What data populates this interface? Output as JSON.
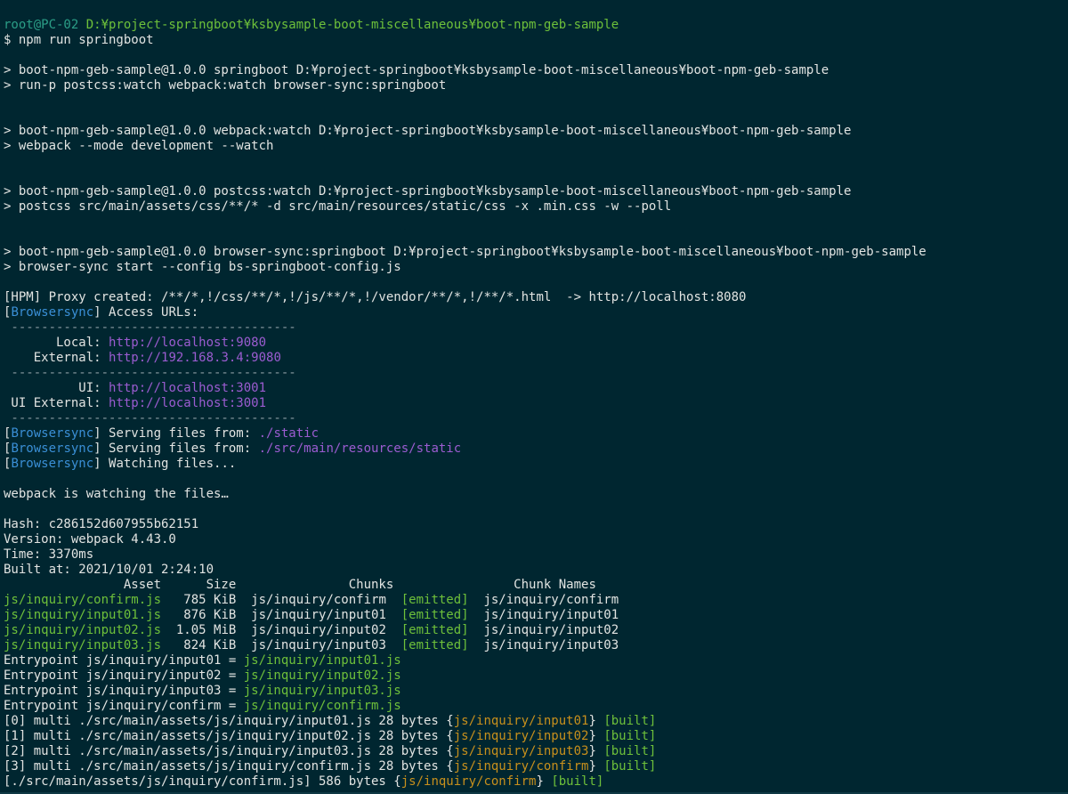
{
  "colors": {
    "background": "#002630",
    "text": "#e2e4e2",
    "green": "#6ec03a",
    "teal": "#2b9e87",
    "blue": "#3a8fd6",
    "purple": "#9b5cd1",
    "orange": "#c8901c"
  },
  "terminal": {
    "lines": [
      [
        {
          "t": "root@PC-02 ",
          "c": "teal"
        },
        {
          "t": "D:¥project-springboot¥ksbysample-boot-miscellaneous¥boot-npm-geb-sample",
          "c": "green"
        }
      ],
      [
        {
          "t": "$ npm run springboot"
        }
      ],
      [],
      [
        {
          "t": "> boot-npm-geb-sample@1.0.0 springboot D:¥project-springboot¥ksbysample-boot-miscellaneous¥boot-npm-geb-sample"
        }
      ],
      [
        {
          "t": "> run-p postcss:watch webpack:watch browser-sync:springboot"
        }
      ],
      [],
      [],
      [
        {
          "t": "> boot-npm-geb-sample@1.0.0 webpack:watch D:¥project-springboot¥ksbysample-boot-miscellaneous¥boot-npm-geb-sample"
        }
      ],
      [
        {
          "t": "> webpack --mode development --watch"
        }
      ],
      [],
      [],
      [
        {
          "t": "> boot-npm-geb-sample@1.0.0 postcss:watch D:¥project-springboot¥ksbysample-boot-miscellaneous¥boot-npm-geb-sample"
        }
      ],
      [
        {
          "t": "> postcss src/main/assets/css/**/* -d src/main/resources/static/css -x .min.css -w --poll"
        }
      ],
      [],
      [],
      [
        {
          "t": "> boot-npm-geb-sample@1.0.0 browser-sync:springboot D:¥project-springboot¥ksbysample-boot-miscellaneous¥boot-npm-geb-sample"
        }
      ],
      [
        {
          "t": "> browser-sync start --config bs-springboot-config.js"
        }
      ],
      [],
      [
        {
          "t": "[HPM] Proxy created: /**/*,!/css/**/*,!/js/**/*,!/vendor/**/*,!/**/*.html  -> http://localhost:8080"
        }
      ],
      [
        {
          "t": "["
        },
        {
          "t": "Browsersync",
          "c": "blue"
        },
        {
          "t": "] Access URLs:"
        }
      ],
      [
        {
          "t": " --------------------------------------",
          "c": "gray"
        }
      ],
      [
        {
          "t": "       Local: "
        },
        {
          "t": "http://localhost:9080",
          "c": "purple"
        }
      ],
      [
        {
          "t": "    External: "
        },
        {
          "t": "http://192.168.3.4:9080",
          "c": "purple"
        }
      ],
      [
        {
          "t": " --------------------------------------",
          "c": "gray"
        }
      ],
      [
        {
          "t": "          UI: "
        },
        {
          "t": "http://localhost:3001",
          "c": "purple"
        }
      ],
      [
        {
          "t": " UI External: "
        },
        {
          "t": "http://localhost:3001",
          "c": "purple"
        }
      ],
      [
        {
          "t": " --------------------------------------",
          "c": "gray"
        }
      ],
      [
        {
          "t": "["
        },
        {
          "t": "Browsersync",
          "c": "blue"
        },
        {
          "t": "] Serving files from: "
        },
        {
          "t": "./static",
          "c": "purple"
        }
      ],
      [
        {
          "t": "["
        },
        {
          "t": "Browsersync",
          "c": "blue"
        },
        {
          "t": "] Serving files from: "
        },
        {
          "t": "./src/main/resources/static",
          "c": "purple"
        }
      ],
      [
        {
          "t": "["
        },
        {
          "t": "Browsersync",
          "c": "blue"
        },
        {
          "t": "] Watching files..."
        }
      ],
      [],
      [
        {
          "t": "webpack is watching the files…"
        }
      ],
      [],
      [
        {
          "t": "Hash: c286152d607955b62151"
        }
      ],
      [
        {
          "t": "Version: webpack 4.43.0"
        }
      ],
      [
        {
          "t": "Time: 3370ms"
        }
      ],
      [
        {
          "t": "Built at: 2021/10/01 2:24:10"
        }
      ],
      [
        {
          "t": "                Asset      Size               Chunks                Chunk Names"
        }
      ],
      [
        {
          "t": "js/inquiry/confirm.js",
          "c": "green"
        },
        {
          "t": "   785 KiB  js/inquiry/confirm  "
        },
        {
          "t": "[emitted]",
          "c": "green"
        },
        {
          "t": "  js/inquiry/confirm"
        }
      ],
      [
        {
          "t": "js/inquiry/input01.js",
          "c": "green"
        },
        {
          "t": "   876 KiB  js/inquiry/input01  "
        },
        {
          "t": "[emitted]",
          "c": "green"
        },
        {
          "t": "  js/inquiry/input01"
        }
      ],
      [
        {
          "t": "js/inquiry/input02.js",
          "c": "green"
        },
        {
          "t": "  1.05 MiB  js/inquiry/input02  "
        },
        {
          "t": "[emitted]",
          "c": "green"
        },
        {
          "t": "  js/inquiry/input02"
        }
      ],
      [
        {
          "t": "js/inquiry/input03.js",
          "c": "green"
        },
        {
          "t": "   824 KiB  js/inquiry/input03  "
        },
        {
          "t": "[emitted]",
          "c": "green"
        },
        {
          "t": "  js/inquiry/input03"
        }
      ],
      [
        {
          "t": "Entrypoint js/inquiry/input01 = "
        },
        {
          "t": "js/inquiry/input01.js",
          "c": "green"
        }
      ],
      [
        {
          "t": "Entrypoint js/inquiry/input02 = "
        },
        {
          "t": "js/inquiry/input02.js",
          "c": "green"
        }
      ],
      [
        {
          "t": "Entrypoint js/inquiry/input03 = "
        },
        {
          "t": "js/inquiry/input03.js",
          "c": "green"
        }
      ],
      [
        {
          "t": "Entrypoint js/inquiry/confirm = "
        },
        {
          "t": "js/inquiry/confirm.js",
          "c": "green"
        }
      ],
      [
        {
          "t": "[0] multi ./src/main/assets/js/inquiry/input01.js 28 bytes {"
        },
        {
          "t": "js/inquiry/input01",
          "c": "orange"
        },
        {
          "t": "} "
        },
        {
          "t": "[built]",
          "c": "green"
        }
      ],
      [
        {
          "t": "[1] multi ./src/main/assets/js/inquiry/input02.js 28 bytes {"
        },
        {
          "t": "js/inquiry/input02",
          "c": "orange"
        },
        {
          "t": "} "
        },
        {
          "t": "[built]",
          "c": "green"
        }
      ],
      [
        {
          "t": "[2] multi ./src/main/assets/js/inquiry/input03.js 28 bytes {"
        },
        {
          "t": "js/inquiry/input03",
          "c": "orange"
        },
        {
          "t": "} "
        },
        {
          "t": "[built]",
          "c": "green"
        }
      ],
      [
        {
          "t": "[3] multi ./src/main/assets/js/inquiry/confirm.js 28 bytes {"
        },
        {
          "t": "js/inquiry/confirm",
          "c": "orange"
        },
        {
          "t": "} "
        },
        {
          "t": "[built]",
          "c": "green"
        }
      ],
      [
        {
          "t": "[./src/main/assets/js/inquiry/confirm.js] 586 bytes {"
        },
        {
          "t": "js/inquiry/confirm",
          "c": "orange"
        },
        {
          "t": "} "
        },
        {
          "t": "[built]",
          "c": "green"
        }
      ]
    ]
  }
}
